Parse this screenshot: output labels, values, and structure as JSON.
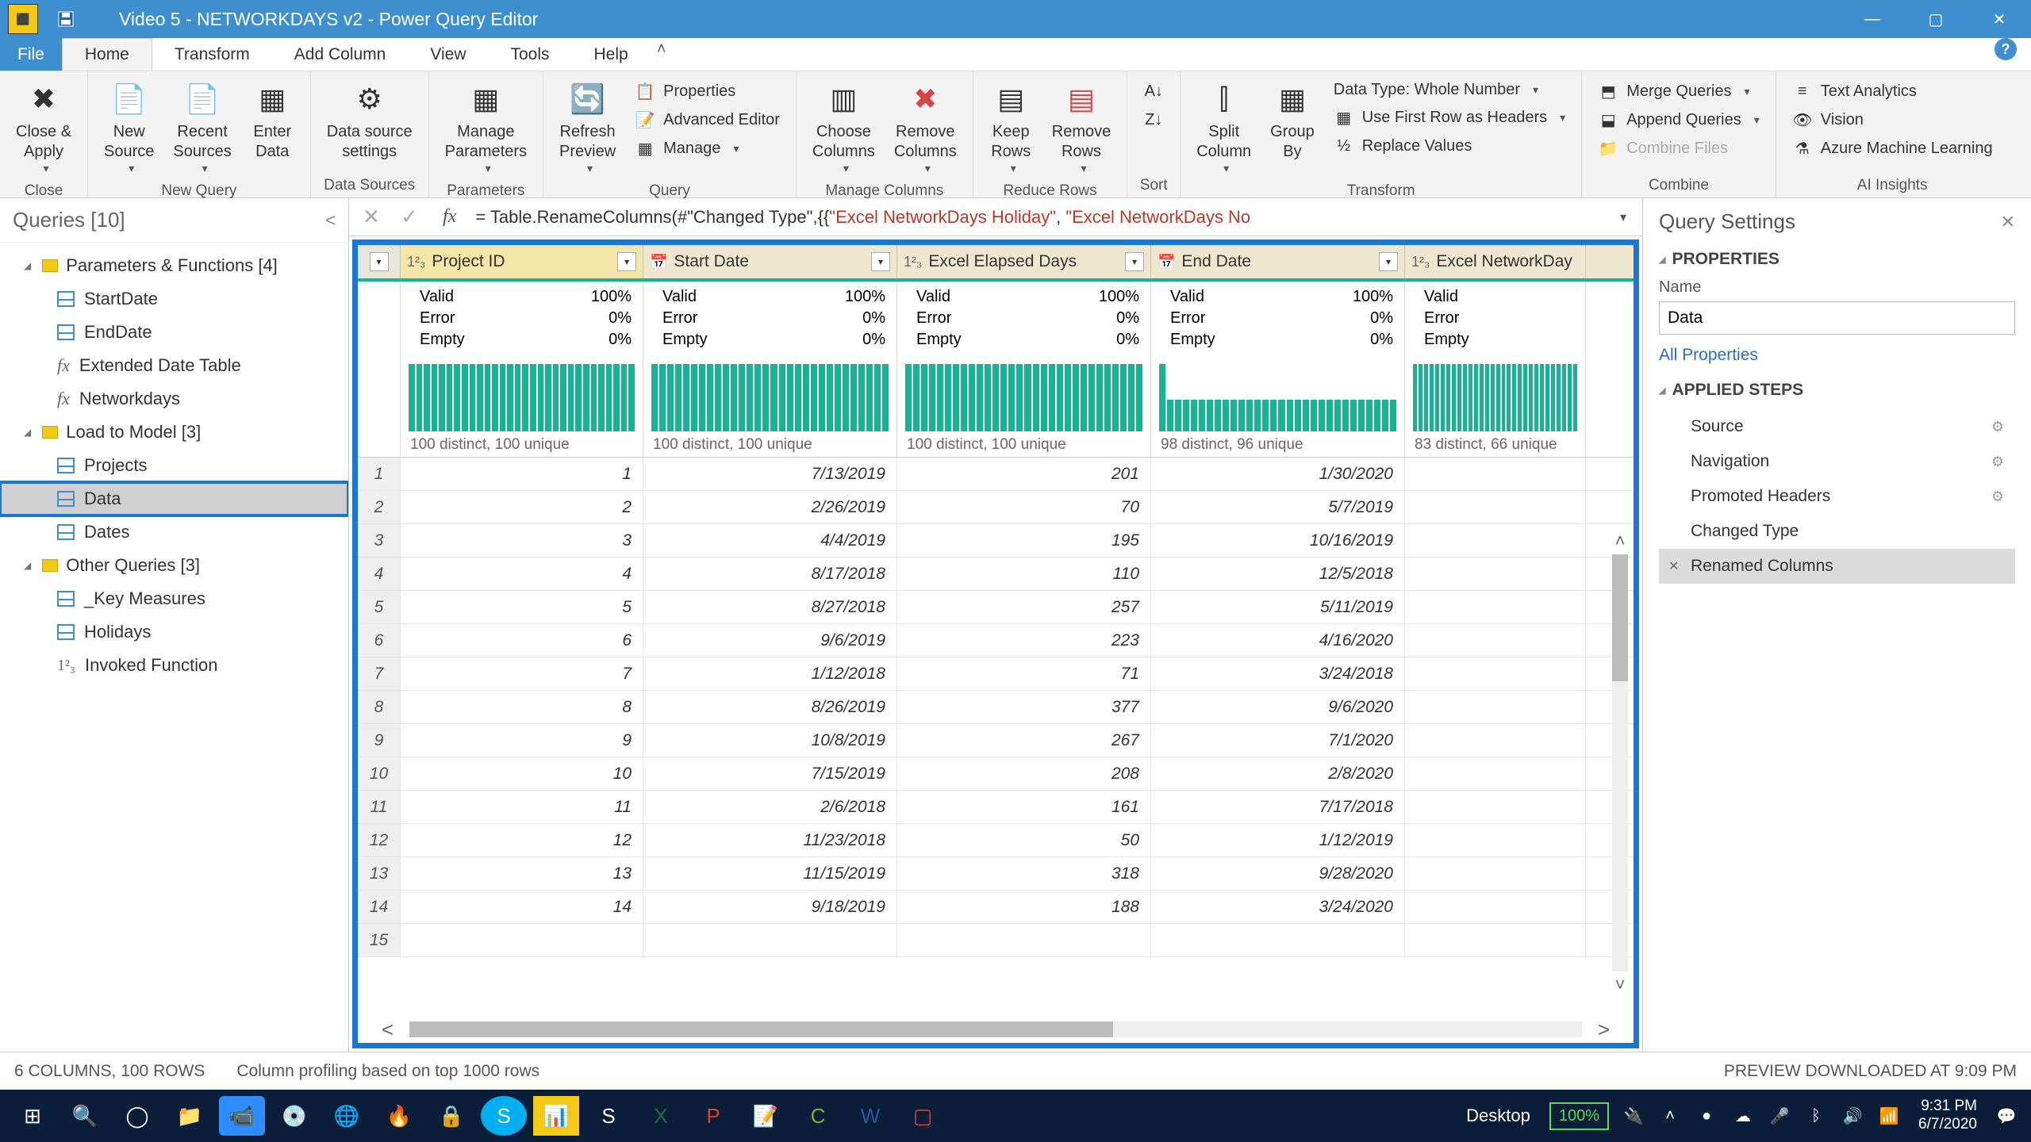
{
  "title": "Video 5 - NETWORKDAYS v2 - Power Query Editor",
  "menu_tabs": {
    "file": "File",
    "home": "Home",
    "transform": "Transform",
    "add_column": "Add Column",
    "view": "View",
    "tools": "Tools",
    "help": "Help"
  },
  "ribbon": {
    "close": {
      "close_apply": "Close &\nApply",
      "group": "Close"
    },
    "new_query": {
      "new_source": "New\nSource",
      "recent_sources": "Recent\nSources",
      "enter_data": "Enter\nData",
      "group": "New Query"
    },
    "data_sources": {
      "settings": "Data source\nsettings",
      "group": "Data Sources"
    },
    "parameters": {
      "manage": "Manage\nParameters",
      "group": "Parameters"
    },
    "query": {
      "refresh": "Refresh\nPreview",
      "properties": "Properties",
      "adv_editor": "Advanced Editor",
      "manage": "Manage",
      "group": "Query"
    },
    "manage_cols": {
      "choose": "Choose\nColumns",
      "remove": "Remove\nColumns",
      "group": "Manage Columns"
    },
    "reduce_rows": {
      "keep": "Keep\nRows",
      "remove": "Remove\nRows",
      "group": "Reduce Rows"
    },
    "sort": {
      "group": "Sort"
    },
    "transform": {
      "split": "Split\nColumn",
      "group_by": "Group\nBy",
      "datatype": "Data Type: Whole Number",
      "first_row": "Use First Row as Headers",
      "replace": "Replace Values",
      "group": "Transform"
    },
    "combine": {
      "merge": "Merge Queries",
      "append": "Append Queries",
      "combine_files": "Combine Files",
      "group": "Combine"
    },
    "ai": {
      "text": "Text Analytics",
      "vision": "Vision",
      "aml": "Azure Machine Learning",
      "group": "AI Insights"
    }
  },
  "queries_pane": {
    "header": "Queries [10]",
    "groups": [
      {
        "label": "Parameters & Functions [4]",
        "items": [
          {
            "type": "table",
            "label": "StartDate"
          },
          {
            "type": "table",
            "label": "EndDate"
          },
          {
            "type": "fx",
            "label": "Extended Date Table"
          },
          {
            "type": "fx",
            "label": "Networkdays"
          }
        ]
      },
      {
        "label": "Load to Model [3]",
        "items": [
          {
            "type": "table",
            "label": "Projects"
          },
          {
            "type": "table",
            "label": "Data",
            "selected": true
          },
          {
            "type": "table",
            "label": "Dates"
          }
        ]
      },
      {
        "label": "Other Queries [3]",
        "items": [
          {
            "type": "table",
            "label": "_Key Measures"
          },
          {
            "type": "table",
            "label": "Holidays"
          },
          {
            "type": "num",
            "label": "Invoked Function"
          }
        ]
      }
    ]
  },
  "formula": {
    "prefix": "= Table.RenameColumns(#\"Changed Type\",{{",
    "str1": "\"Excel NetworkDays  Holiday\"",
    "mid": ", ",
    "str2": "\"Excel NetworkDays No"
  },
  "grid": {
    "columns": [
      {
        "type": "1²₃",
        "name": "Project ID"
      },
      {
        "type": "📅",
        "name": "Start Date"
      },
      {
        "type": "1²₃",
        "name": "Excel Elapsed Days"
      },
      {
        "type": "📅",
        "name": "End Date"
      },
      {
        "type": "1²₃",
        "name": "Excel NetworkDay"
      }
    ],
    "quality": [
      {
        "valid": "100%",
        "error": "0%",
        "empty": "0%"
      },
      {
        "valid": "100%",
        "error": "0%",
        "empty": "0%"
      },
      {
        "valid": "100%",
        "error": "0%",
        "empty": "0%"
      },
      {
        "valid": "100%",
        "error": "0%",
        "empty": "0%"
      },
      {
        "valid": "",
        "error": "",
        "empty": ""
      }
    ],
    "distinct": [
      "100 distinct, 100 unique",
      "100 distinct, 100 unique",
      "100 distinct, 100 unique",
      "98 distinct, 96 unique",
      "83 distinct, 66 unique"
    ],
    "rows": [
      {
        "n": 1,
        "pid": "1",
        "start": "7/13/2019",
        "elapsed": "201",
        "end": "1/30/2020"
      },
      {
        "n": 2,
        "pid": "2",
        "start": "2/26/2019",
        "elapsed": "70",
        "end": "5/7/2019"
      },
      {
        "n": 3,
        "pid": "3",
        "start": "4/4/2019",
        "elapsed": "195",
        "end": "10/16/2019"
      },
      {
        "n": 4,
        "pid": "4",
        "start": "8/17/2018",
        "elapsed": "110",
        "end": "12/5/2018"
      },
      {
        "n": 5,
        "pid": "5",
        "start": "8/27/2018",
        "elapsed": "257",
        "end": "5/11/2019"
      },
      {
        "n": 6,
        "pid": "6",
        "start": "9/6/2019",
        "elapsed": "223",
        "end": "4/16/2020"
      },
      {
        "n": 7,
        "pid": "7",
        "start": "1/12/2018",
        "elapsed": "71",
        "end": "3/24/2018"
      },
      {
        "n": 8,
        "pid": "8",
        "start": "8/26/2019",
        "elapsed": "377",
        "end": "9/6/2020"
      },
      {
        "n": 9,
        "pid": "9",
        "start": "10/8/2019",
        "elapsed": "267",
        "end": "7/1/2020"
      },
      {
        "n": 10,
        "pid": "10",
        "start": "7/15/2019",
        "elapsed": "208",
        "end": "2/8/2020"
      },
      {
        "n": 11,
        "pid": "11",
        "start": "2/6/2018",
        "elapsed": "161",
        "end": "7/17/2018"
      },
      {
        "n": 12,
        "pid": "12",
        "start": "11/23/2018",
        "elapsed": "50",
        "end": "1/12/2019"
      },
      {
        "n": 13,
        "pid": "13",
        "start": "11/15/2019",
        "elapsed": "318",
        "end": "9/28/2020"
      },
      {
        "n": 14,
        "pid": "14",
        "start": "9/18/2019",
        "elapsed": "188",
        "end": "3/24/2020"
      },
      {
        "n": 15,
        "pid": "",
        "start": "",
        "elapsed": "",
        "end": ""
      }
    ]
  },
  "settings": {
    "title": "Query Settings",
    "properties": "PROPERTIES",
    "name_label": "Name",
    "name_value": "Data",
    "all_props": "All Properties",
    "applied_steps": "APPLIED STEPS",
    "steps": [
      {
        "label": "Source",
        "gear": true
      },
      {
        "label": "Navigation",
        "gear": true
      },
      {
        "label": "Promoted Headers",
        "gear": true
      },
      {
        "label": "Changed Type",
        "gear": false
      },
      {
        "label": "Renamed Columns",
        "gear": false,
        "selected": true
      }
    ]
  },
  "status": {
    "left": "6 COLUMNS, 100 ROWS",
    "mid": "Column profiling based on top 1000 rows",
    "right": "PREVIEW DOWNLOADED AT 9:09 PM"
  },
  "taskbar": {
    "desktop": "Desktop",
    "battery": "100%",
    "time": "9:31 PM",
    "date": "6/7/2020"
  },
  "q_labels": {
    "valid": "Valid",
    "error": "Error",
    "empty": "Empty"
  }
}
